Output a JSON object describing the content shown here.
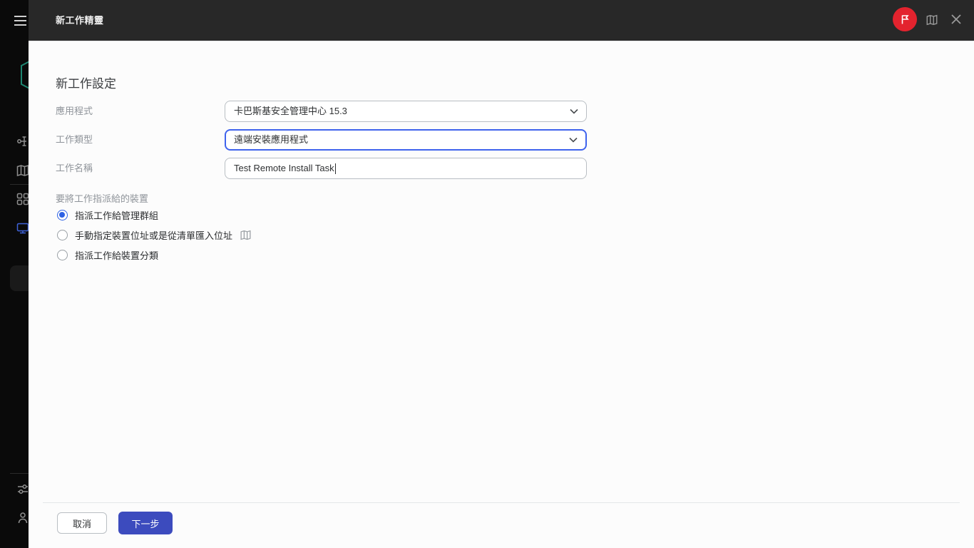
{
  "topbar": {
    "title": "新工作精靈",
    "brand_icon": "flag-icon",
    "brand_color": "#e3232e",
    "help_icon": "book-icon",
    "close_icon": "close-icon"
  },
  "sidebar": {
    "menu_icon": "hamburger-icon",
    "logo_icon": "kaspersky-hexagon-logo",
    "logo_color": "#1d8570",
    "items": [
      {
        "icon": "server-hierarchy-icon"
      },
      {
        "icon": "map-book-icon"
      },
      {
        "icon": "dashboard-grid-icon"
      },
      {
        "icon": "devices-monitor-icon",
        "active_color": "#3e62d8"
      },
      {
        "icon": "settings-sliders-icon"
      },
      {
        "icon": "user-icon"
      }
    ]
  },
  "wizard": {
    "heading": "新工作設定",
    "fields": [
      {
        "label": "應用程式",
        "value": "卡巴斯基安全管理中心 15.3",
        "type": "select",
        "focused": false
      },
      {
        "label": "工作類型",
        "value": "遠端安裝應用程式",
        "type": "select",
        "focused": true
      },
      {
        "label": "工作名稱",
        "value": "Test Remote Install Task",
        "type": "text"
      }
    ],
    "section_label": "要將工作指派給的裝置",
    "radios": [
      {
        "label": "指派工作給管理群組",
        "selected": true
      },
      {
        "label": "手動指定裝置位址或是從清單匯入位址",
        "selected": false,
        "help_icon": "book-icon"
      },
      {
        "label": "指派工作給裝置分類",
        "selected": false
      }
    ],
    "footer": {
      "cancel_label": "取消",
      "next_label": "下一步"
    }
  },
  "colors": {
    "accent_focus": "#3f63ed",
    "radio_selected": "#2d61e4",
    "primary_button": "#3c4bbe",
    "brand_red": "#e3232e"
  }
}
